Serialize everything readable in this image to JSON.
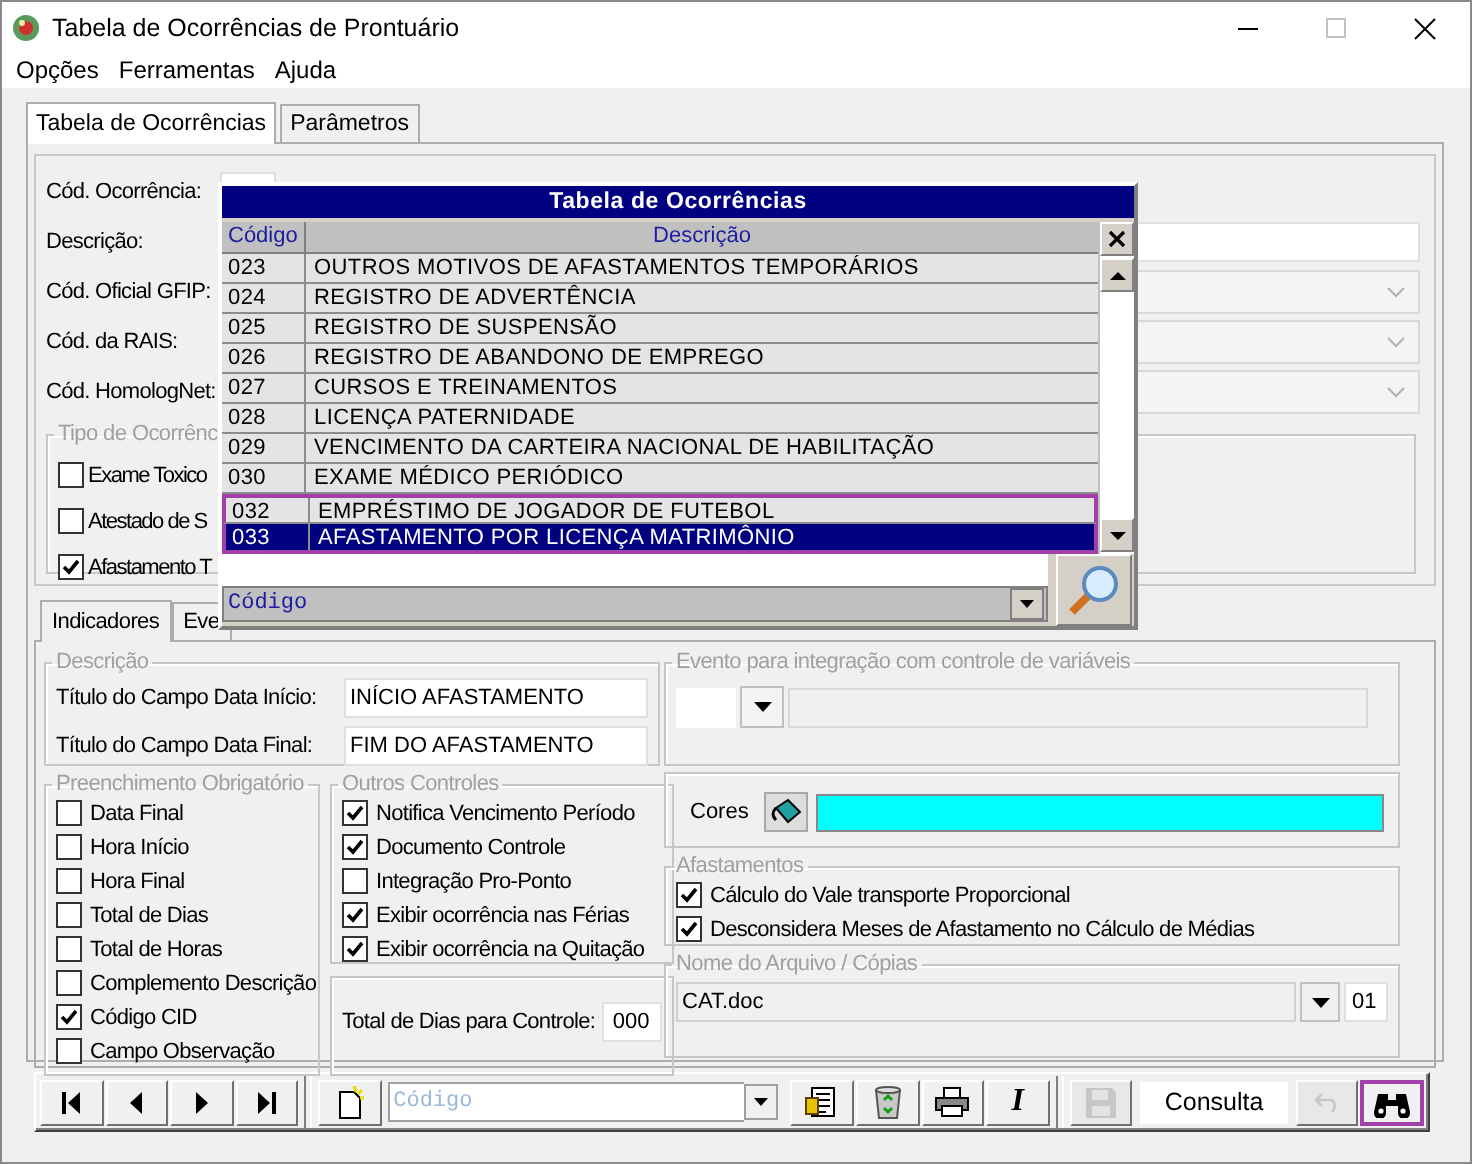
{
  "window": {
    "title": "Tabela de Ocorrências de Prontuário"
  },
  "menu": [
    "Opções",
    "Ferramentas",
    "Ajuda"
  ],
  "tabs": [
    {
      "label": "Tabela de Ocorrências",
      "selected": true
    },
    {
      "label": "Parâmetros",
      "selected": false
    }
  ],
  "fields": [
    {
      "label": "Cód. Ocorrência:",
      "kind": "short"
    },
    {
      "label": "Descrição:",
      "kind": "text"
    },
    {
      "label": "Cód. Oficial GFIP:",
      "kind": "combo"
    },
    {
      "label": "Cód. da RAIS:",
      "kind": "combo"
    },
    {
      "label": "Cód. HomologNet:",
      "kind": "combo"
    }
  ],
  "tipo_group": {
    "legend": "Tipo de Ocorrênc",
    "options": [
      {
        "label": "Exame Toxico",
        "checked": false
      },
      {
        "label": "Atestado de S",
        "checked": false
      },
      {
        "label": "Afastamento T",
        "checked": true
      }
    ]
  },
  "inner_tabs": [
    {
      "label": "Indicadores",
      "selected": true
    },
    {
      "label": "Eve",
      "selected": false
    }
  ],
  "descricao": {
    "legend": "Descrição",
    "rows": [
      {
        "label": "Título do Campo Data Início:",
        "value": "INÍCIO AFASTAMENTO"
      },
      {
        "label": "Título do Campo Data Final:",
        "value": "FIM DO AFASTAMENTO"
      }
    ]
  },
  "evento": {
    "legend": "Evento para integração com controle de variáveis"
  },
  "preenchimento": {
    "legend": "Preenchimento Obrigatório",
    "options": [
      {
        "label": "Data Final",
        "checked": false
      },
      {
        "label": "Hora Início",
        "checked": false
      },
      {
        "label": "Hora Final",
        "checked": false
      },
      {
        "label": "Total de Dias",
        "checked": false
      },
      {
        "label": "Total de Horas",
        "checked": false
      },
      {
        "label": "Complemento Descrição",
        "checked": false
      },
      {
        "label": "Código CID",
        "checked": true
      },
      {
        "label": "Campo Observação",
        "checked": false
      }
    ]
  },
  "outros": {
    "legend": "Outros Controles",
    "options": [
      {
        "label": "Notifica Vencimento Período",
        "checked": true
      },
      {
        "label": "Documento Controle",
        "checked": true
      },
      {
        "label": "Integração Pro-Ponto",
        "checked": false
      },
      {
        "label": "Exibir ocorrência nas Férias",
        "checked": true
      },
      {
        "label": "Exibir ocorrência na Quitação",
        "checked": true
      }
    ]
  },
  "total_dias": {
    "label": "Total de Dias para Controle:",
    "value": "000"
  },
  "cores": {
    "label": "Cores",
    "color": "#00ffff"
  },
  "afastamentos": {
    "legend": "Afastamentos",
    "options": [
      {
        "label": "Cálculo do Vale transporte Proporcional",
        "checked": true
      },
      {
        "label": "Desconsidera Meses de Afastamento no Cálculo de Médias",
        "checked": true
      }
    ]
  },
  "arquivo": {
    "legend": "Nome do Arquivo / Cópias",
    "file": "CAT.doc",
    "copies": "01"
  },
  "toolbar": {
    "search_placeholder": "Código",
    "status": "Consulta",
    "buttons": [
      {
        "kind": "first",
        "disabled": false,
        "marked": false
      },
      {
        "kind": "prev",
        "disabled": false,
        "marked": false
      },
      {
        "kind": "next",
        "disabled": false,
        "marked": false
      },
      {
        "kind": "last",
        "disabled": false,
        "marked": false
      },
      {
        "kind": "new",
        "disabled": false,
        "marked": false
      },
      {
        "kind": "search",
        "disabled": false,
        "marked": false
      },
      {
        "kind": "report",
        "disabled": false,
        "marked": false
      },
      {
        "kind": "recycle",
        "disabled": false,
        "marked": false
      },
      {
        "kind": "print",
        "disabled": false,
        "marked": false
      },
      {
        "kind": "italic",
        "glyph": "I",
        "disabled": false,
        "marked": false
      },
      {
        "kind": "save",
        "disabled": true,
        "marked": false
      },
      {
        "kind": "status",
        "disabled": false,
        "marked": false
      },
      {
        "kind": "undo",
        "disabled": true,
        "marked": false
      },
      {
        "kind": "find",
        "disabled": false,
        "marked": true
      }
    ]
  },
  "popup": {
    "title": "Tabela de Ocorrências",
    "columns": [
      "Código",
      "Descrição"
    ],
    "search_value": "Código",
    "rows": [
      {
        "code": "023",
        "description": "OUTROS MOTIVOS DE AFASTAMENTOS TEMPORÁRIOS",
        "selected": false,
        "marked": false
      },
      {
        "code": "024",
        "description": "REGISTRO DE ADVERTÊNCIA",
        "selected": false,
        "marked": false
      },
      {
        "code": "025",
        "description": "REGISTRO DE SUSPENSÃO",
        "selected": false,
        "marked": false
      },
      {
        "code": "026",
        "description": "REGISTRO DE ABANDONO DE EMPREGO",
        "selected": false,
        "marked": false
      },
      {
        "code": "027",
        "description": "CURSOS E TREINAMENTOS",
        "selected": false,
        "marked": false
      },
      {
        "code": "028",
        "description": "LICENÇA PATERNIDADE",
        "selected": false,
        "marked": false
      },
      {
        "code": "029",
        "description": "VENCIMENTO DA CARTEIRA NACIONAL DE HABILITAÇÃO",
        "selected": false,
        "marked": false
      },
      {
        "code": "030",
        "description": "EXAME MÉDICO PERIÓDICO",
        "selected": false,
        "marked": false
      },
      {
        "code": "032",
        "description": "EMPRÉSTIMO DE JOGADOR DE FUTEBOL",
        "selected": false,
        "marked": true
      },
      {
        "code": "033",
        "description": "AFASTAMENTO POR LICENÇA MATRIMÔNIO",
        "selected": true,
        "marked": true
      }
    ]
  }
}
